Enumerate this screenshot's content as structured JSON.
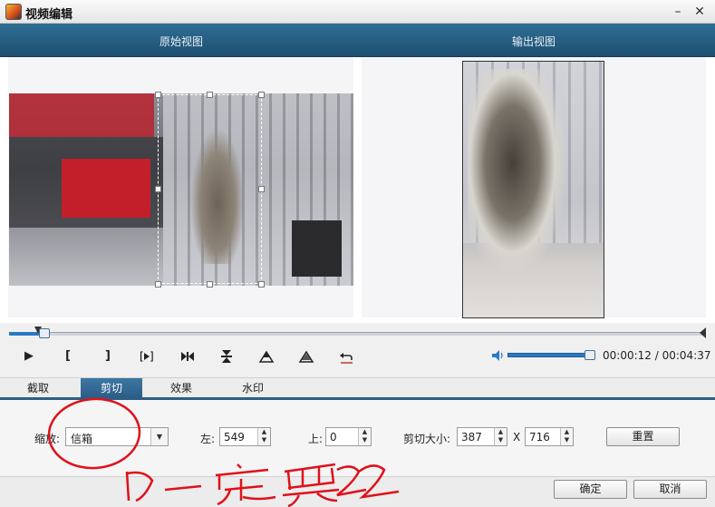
{
  "window": {
    "title": "视频编辑",
    "minimize_glyph": "–",
    "close_glyph": "✕"
  },
  "views": {
    "original_label": "原始视图",
    "output_label": "输出视图"
  },
  "playback": {
    "play_glyph": "▶",
    "mark_in_glyph": "[",
    "mark_out_glyph": "]",
    "icons": [
      "play-icon",
      "mark-in-icon",
      "mark-out-icon",
      "frame-step-icon",
      "previous-next-icon",
      "flip-vertical-icon",
      "rotate-left-icon",
      "rotate-right-icon",
      "undo-icon"
    ],
    "current_time": "00:00:12",
    "separator": " / ",
    "total_time": "00:04:37",
    "progress_fraction": 0.045,
    "volume_fraction": 0.95
  },
  "tabs": [
    {
      "label": "截取",
      "active": false
    },
    {
      "label": "剪切",
      "active": true
    },
    {
      "label": "效果",
      "active": false
    },
    {
      "label": "水印",
      "active": false
    }
  ],
  "crop_form": {
    "zoom_label": "缩放:",
    "zoom_value": "信箱",
    "left_label": "左:",
    "left_value": "549",
    "top_label": "上:",
    "top_value": "0",
    "size_label": "剪切大小:",
    "width_value": "387",
    "x_separator": "X",
    "height_value": "716",
    "reset_label": "重置"
  },
  "footer": {
    "ok_label": "确定",
    "cancel_label": "取消"
  },
  "annotation": {
    "handwritten_text": "一定要改",
    "ink_color": "#e0101a"
  },
  "colors": {
    "header_blue": "#2f6e95",
    "accent_blue": "#2b79c2",
    "tab_active": "#3c77a3"
  }
}
